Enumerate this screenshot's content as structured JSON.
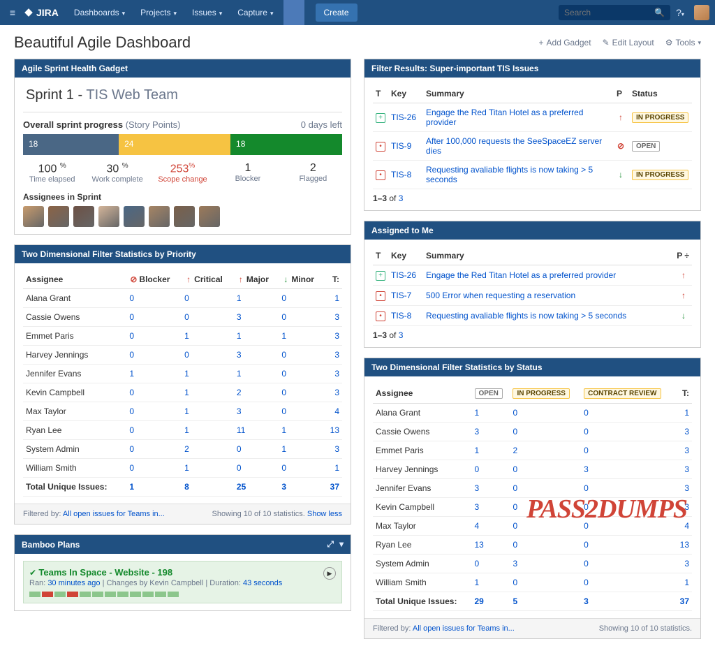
{
  "nav": {
    "logo": "JIRA",
    "items": [
      "Dashboards",
      "Projects",
      "Issues",
      "Capture"
    ],
    "create": "Create",
    "search_placeholder": "Search"
  },
  "page": {
    "title": "Beautiful Agile Dashboard",
    "add_gadget": "Add Gadget",
    "edit_layout": "Edit Layout",
    "tools": "Tools"
  },
  "sprint": {
    "gadget_title": "Agile Sprint Health Gadget",
    "name": "Sprint 1",
    "team": "TIS Web Team",
    "progress_label": "Overall sprint progress",
    "progress_units": "(Story Points)",
    "days_left": "0 days left",
    "bars": {
      "elapsed": "18",
      "complete": "24",
      "remain": "18"
    },
    "stats": {
      "elapsed": {
        "v": "100",
        "u": "%",
        "l": "Time elapsed"
      },
      "complete": {
        "v": "30",
        "u": "%",
        "l": "Work complete"
      },
      "scope": {
        "v": "253",
        "u": "%",
        "l": "Scope change"
      },
      "blocker": {
        "v": "1",
        "l": "Blocker"
      },
      "flagged": {
        "v": "2",
        "l": "Flagged"
      }
    },
    "assignees_label": "Assignees in Sprint",
    "assignee_colors": [
      "#c89b6d",
      "#8b6346",
      "#6d5145",
      "#d4b59a",
      "#4a6785",
      "#a68565",
      "#7a604a",
      "#9c7a5a"
    ]
  },
  "filter": {
    "gadget_title": "Filter Results: Super-important TIS Issues",
    "cols": {
      "t": "T",
      "key": "Key",
      "summary": "Summary",
      "p": "P",
      "status": "Status"
    },
    "rows": [
      {
        "type": "story",
        "key": "TIS-26",
        "summary": "Engage the Red Titan Hotel as a preferred provider",
        "p": "up",
        "status": "IN PROGRESS",
        "stclass": "loz-progress"
      },
      {
        "type": "bug",
        "key": "TIS-9",
        "summary": "After 100,000 requests the SeeSpaceEZ server dies",
        "p": "blocker",
        "status": "OPEN",
        "stclass": "loz-open"
      },
      {
        "type": "bug",
        "key": "TIS-8",
        "summary": "Requesting avaliable flights is now taking > 5 seconds",
        "p": "down",
        "status": "IN PROGRESS",
        "stclass": "loz-progress"
      }
    ],
    "count": "1–3 of 3"
  },
  "assigned": {
    "gadget_title": "Assigned to Me",
    "cols": {
      "t": "T",
      "key": "Key",
      "summary": "Summary",
      "p": "P ÷"
    },
    "rows": [
      {
        "type": "story",
        "key": "TIS-26",
        "summary": "Engage the Red Titan Hotel as a preferred provider",
        "p": "up"
      },
      {
        "type": "bug",
        "key": "TIS-7",
        "summary": "500 Error when requesting a reservation",
        "p": "up"
      },
      {
        "type": "bug",
        "key": "TIS-8",
        "summary": "Requesting avaliable flights is now taking > 5 seconds",
        "p": "down"
      }
    ],
    "count": "1–3 of 3"
  },
  "stats_priority": {
    "gadget_title": "Two Dimensional Filter Statistics by Priority",
    "assignee_h": "Assignee",
    "cols": [
      "Blocker",
      "Critical",
      "Major",
      "Minor",
      "T:"
    ],
    "rows": [
      {
        "name": "Alana Grant",
        "v": [
          "0",
          "0",
          "1",
          "0",
          "1"
        ]
      },
      {
        "name": "Cassie Owens",
        "v": [
          "0",
          "0",
          "3",
          "0",
          "3"
        ]
      },
      {
        "name": "Emmet Paris",
        "v": [
          "0",
          "1",
          "1",
          "1",
          "3"
        ]
      },
      {
        "name": "Harvey Jennings",
        "v": [
          "0",
          "0",
          "3",
          "0",
          "3"
        ]
      },
      {
        "name": "Jennifer Evans",
        "v": [
          "1",
          "1",
          "1",
          "0",
          "3"
        ]
      },
      {
        "name": "Kevin Campbell",
        "v": [
          "0",
          "1",
          "2",
          "0",
          "3"
        ]
      },
      {
        "name": "Max Taylor",
        "v": [
          "0",
          "1",
          "3",
          "0",
          "4"
        ]
      },
      {
        "name": "Ryan Lee",
        "v": [
          "0",
          "1",
          "11",
          "1",
          "13"
        ]
      },
      {
        "name": "System Admin",
        "v": [
          "0",
          "2",
          "0",
          "1",
          "3"
        ]
      },
      {
        "name": "William Smith",
        "v": [
          "0",
          "1",
          "0",
          "0",
          "1"
        ]
      }
    ],
    "total": {
      "label": "Total Unique Issues:",
      "v": [
        "1",
        "8",
        "25",
        "3",
        "37"
      ]
    },
    "foot_filter": "Filtered by:",
    "foot_link": "All open issues for Teams in...",
    "foot_right_a": "Showing 10 of 10 statistics.",
    "foot_right_b": "Show less"
  },
  "stats_status": {
    "gadget_title": "Two Dimensional Filter Statistics by Status",
    "assignee_h": "Assignee",
    "cols": [
      "OPEN",
      "IN PROGRESS",
      "CONTRACT REVIEW",
      "T:"
    ],
    "rows": [
      {
        "name": "Alana Grant",
        "v": [
          "1",
          "0",
          "0",
          "1"
        ]
      },
      {
        "name": "Cassie Owens",
        "v": [
          "3",
          "0",
          "0",
          "3"
        ]
      },
      {
        "name": "Emmet Paris",
        "v": [
          "1",
          "2",
          "0",
          "3"
        ]
      },
      {
        "name": "Harvey Jennings",
        "v": [
          "0",
          "0",
          "3",
          "3"
        ]
      },
      {
        "name": "Jennifer Evans",
        "v": [
          "3",
          "0",
          "0",
          "3"
        ]
      },
      {
        "name": "Kevin Campbell",
        "v": [
          "3",
          "0",
          "0",
          "3"
        ]
      },
      {
        "name": "Max Taylor",
        "v": [
          "4",
          "0",
          "0",
          "4"
        ]
      },
      {
        "name": "Ryan Lee",
        "v": [
          "13",
          "0",
          "0",
          "13"
        ]
      },
      {
        "name": "System Admin",
        "v": [
          "0",
          "3",
          "0",
          "3"
        ]
      },
      {
        "name": "William Smith",
        "v": [
          "1",
          "0",
          "0",
          "1"
        ]
      }
    ],
    "total": {
      "label": "Total Unique Issues:",
      "v": [
        "29",
        "5",
        "3",
        "37"
      ]
    },
    "foot_filter": "Filtered by:",
    "foot_link": "All open issues for Teams in...",
    "foot_right": "Showing 10 of 10 statistics."
  },
  "bamboo": {
    "gadget_title": "Bamboo Plans",
    "title": "Teams In Space - Website - 198",
    "ran": "Ran:",
    "ran_v": "30 minutes ago",
    "changes": "| Changes by Kevin Campbell |",
    "duration": "Duration:",
    "duration_v": "43 seconds",
    "squares": [
      "#8cc68c",
      "#d04437",
      "#8cc68c",
      "#d04437",
      "#8cc68c",
      "#8cc68c",
      "#8cc68c",
      "#8cc68c",
      "#8cc68c",
      "#8cc68c",
      "#8cc68c",
      "#8cc68c"
    ]
  },
  "watermark": "PASS2DUMPS"
}
